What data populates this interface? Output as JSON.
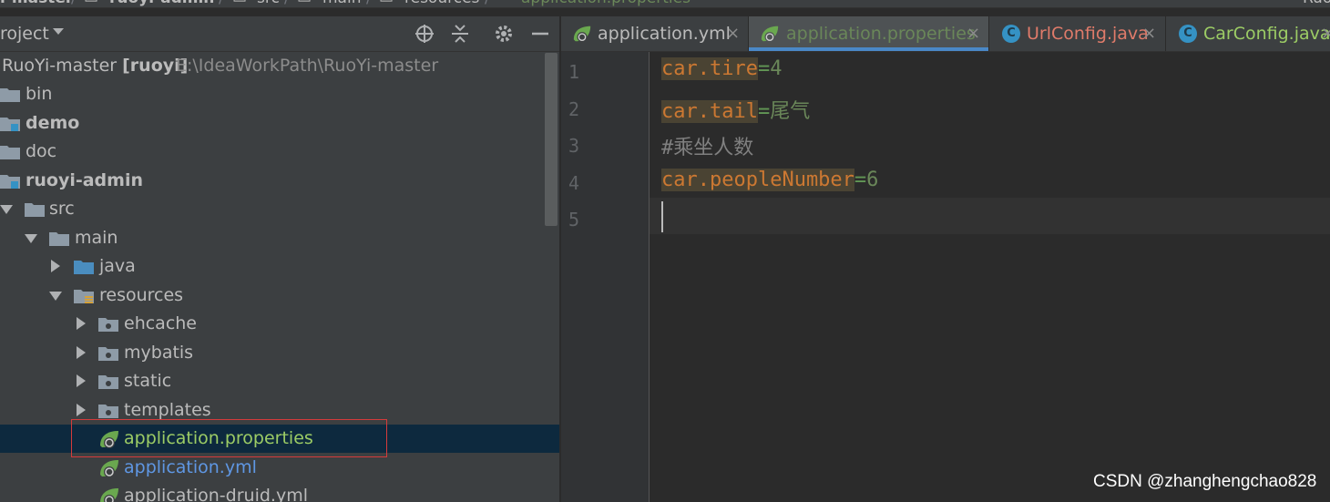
{
  "breadcrumb": {
    "items": [
      "i-master",
      "ruoyi-admin",
      "src",
      "main",
      "resources",
      "application.properties"
    ],
    "right_label": "Ruo"
  },
  "project_panel": {
    "title": "roject",
    "header_icons": [
      "target-icon",
      "collapse-all-icon",
      "gear-icon",
      "minimize-icon"
    ],
    "tree": [
      {
        "label": "RuoYi-master [ruoyi]",
        "path": "E:\\IdeaWorkPath\\RuoYi-master",
        "icon": "module-icon"
      },
      {
        "label": "bin",
        "icon": "folder-icon"
      },
      {
        "label": "demo",
        "icon": "module-folder-icon"
      },
      {
        "label": "doc",
        "icon": "folder-icon"
      },
      {
        "label": "ruoyi-admin",
        "icon": "module-folder-icon"
      },
      {
        "label": "src",
        "icon": "folder-icon"
      },
      {
        "label": "main",
        "icon": "folder-icon"
      },
      {
        "label": "java",
        "icon": "source-folder-icon"
      },
      {
        "label": "resources",
        "icon": "resources-folder-icon"
      },
      {
        "label": "ehcache",
        "icon": "folder-icon"
      },
      {
        "label": "mybatis",
        "icon": "folder-icon"
      },
      {
        "label": "static",
        "icon": "folder-icon"
      },
      {
        "label": "templates",
        "icon": "folder-icon"
      },
      {
        "label": "application.properties",
        "icon": "spring-leaf-icon",
        "selected": true
      },
      {
        "label": "application.yml",
        "icon": "spring-leaf-icon"
      },
      {
        "label": "application-druid.yml",
        "icon": "spring-leaf-icon"
      }
    ]
  },
  "tabs": [
    {
      "label": "application.yml",
      "icon": "spring-leaf-icon",
      "close": "×"
    },
    {
      "label": "application.properties",
      "icon": "spring-leaf-icon",
      "close": "×",
      "active": true
    },
    {
      "label": "UrlConfig.java",
      "icon": "class-c-icon",
      "close": "×"
    },
    {
      "label": "CarConfig.java",
      "icon": "class-c-icon",
      "close": "×"
    }
  ],
  "editor": {
    "line_numbers": [
      "1",
      "2",
      "3",
      "4",
      "5"
    ],
    "lines": [
      {
        "key": "car.tire",
        "eq": "=",
        "value": "4"
      },
      {
        "key": "car.tail",
        "eq": "=",
        "value": "尾气"
      },
      {
        "comment": "#乘坐人数"
      },
      {
        "key": "car.peopleNumber",
        "eq": "=",
        "value": "6"
      },
      {
        "text": ""
      }
    ]
  },
  "watermark": "CSDN @zhanghengchao828",
  "colors": {
    "panel_bg": "#3c3f41",
    "editor_bg": "#2b2b2b",
    "selection": "#0d293e",
    "highlight_border": "#d43b3b",
    "key": "#cc7832",
    "value": "#6a8759",
    "active_tab_underline": "#4a88c7"
  }
}
